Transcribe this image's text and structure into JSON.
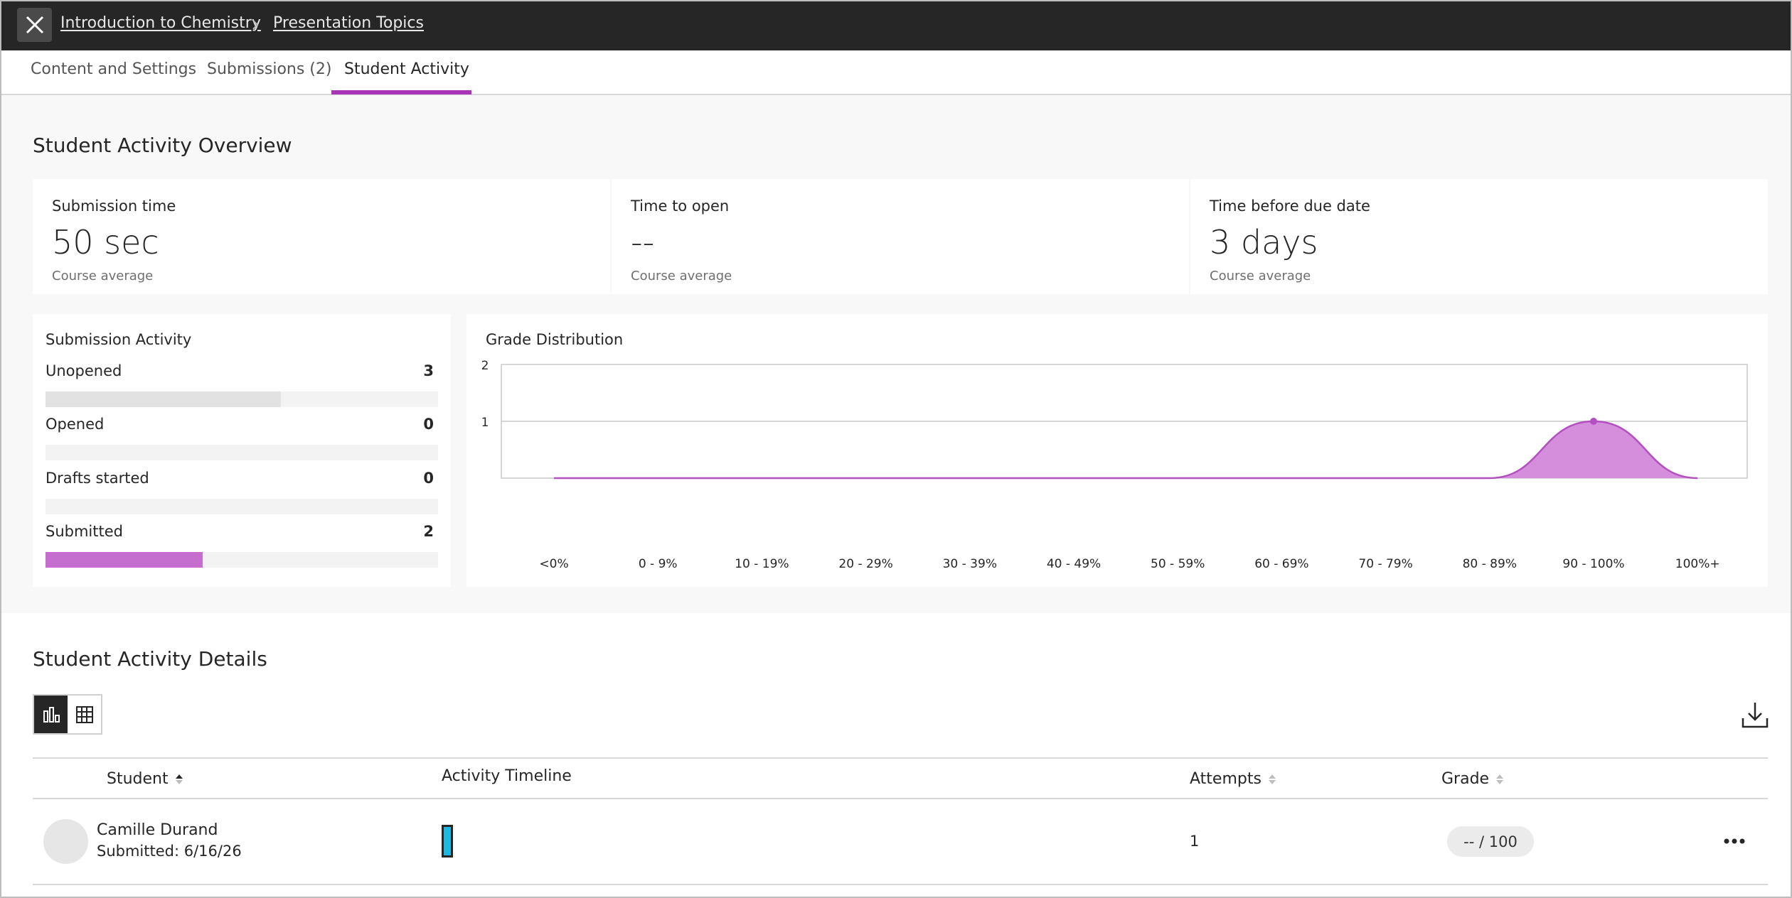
{
  "breadcrumb": {
    "course": "Introduction to Chemistry",
    "item": "Presentation Topics"
  },
  "tabs": [
    {
      "label": "Content and Settings"
    },
    {
      "label": "Submissions (2)"
    },
    {
      "label": "Student Activity"
    }
  ],
  "active_tab": "Student Activity",
  "overview": {
    "title": "Student Activity Overview",
    "stats": [
      {
        "label": "Submission time",
        "value": "50 sec",
        "sub": "Course average"
      },
      {
        "label": "Time to open",
        "value": "--",
        "sub": "Course average"
      },
      {
        "label": "Time before due date",
        "value": "3 days",
        "sub": "Course average"
      }
    ]
  },
  "submission_activity": {
    "title": "Submission Activity",
    "max": 5,
    "rows": [
      {
        "label": "Unopened",
        "count": "3",
        "value": 3,
        "color": "#e2e2e2"
      },
      {
        "label": "Opened",
        "count": "0",
        "value": 0,
        "color": "#e2e2e2"
      },
      {
        "label": "Drafts started",
        "count": "0",
        "value": 0,
        "color": "#e2e2e2"
      },
      {
        "label": "Submitted",
        "count": "2",
        "value": 2,
        "color": "#c66ed0"
      }
    ]
  },
  "chart_data": {
    "type": "area",
    "title": "Grade Distribution",
    "categories": [
      "<0%",
      "0 - 9%",
      "10 - 19%",
      "20 - 29%",
      "30 - 39%",
      "40 - 49%",
      "50 - 59%",
      "60 - 69%",
      "70 - 79%",
      "80 - 89%",
      "90 - 100%",
      "100%+"
    ],
    "values": [
      0,
      0,
      0,
      0,
      0,
      0,
      0,
      0,
      0,
      0,
      1,
      0
    ],
    "y_ticks": [
      "1",
      "2"
    ],
    "ylim": [
      0,
      2
    ],
    "grid": true,
    "fill_color": "#d58edc",
    "line_color": "#b44fc1"
  },
  "details": {
    "title": "Student Activity Details",
    "columns": {
      "student": "Student",
      "timeline": "Activity Timeline",
      "attempts": "Attempts",
      "grade": "Grade"
    },
    "rows": [
      {
        "name": "Camille Durand",
        "status": "Submitted: 6/16/26",
        "attempts": "1",
        "grade": "--  / 100"
      }
    ]
  },
  "colors": {
    "accent": "#a733b6",
    "topbar": "#262626",
    "timeline": "#1fb8e0"
  }
}
